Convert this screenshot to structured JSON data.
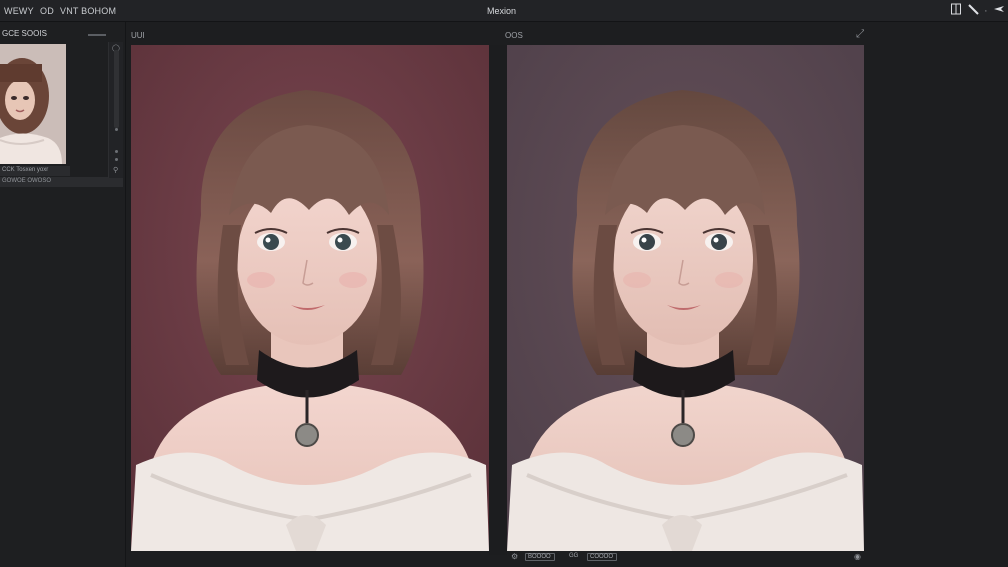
{
  "menu": {
    "file": "WEWY",
    "edit": "OD",
    "view": "VNT BOHOM"
  },
  "window": {
    "title": "Mexion"
  },
  "thumbs": {
    "title": "GCE SOOIS",
    "caption": "CCK  Tosxen   yoxr",
    "bottom": "GOWOE OWOSO"
  },
  "panes": {
    "left_label": "UUI",
    "right_label": "OOS"
  },
  "status": {
    "chip1": "BOOOO",
    "zoom": "GG",
    "chip2": "COOOO"
  },
  "icons": {
    "panel": "panel-toggle-icon",
    "brush": "brush-icon",
    "pin": "pin-icon",
    "corner": "expand-icon"
  },
  "colors": {
    "left_background": "#6e3c45",
    "right_background": "#5a4a52",
    "app_background": "#1d1e20"
  }
}
